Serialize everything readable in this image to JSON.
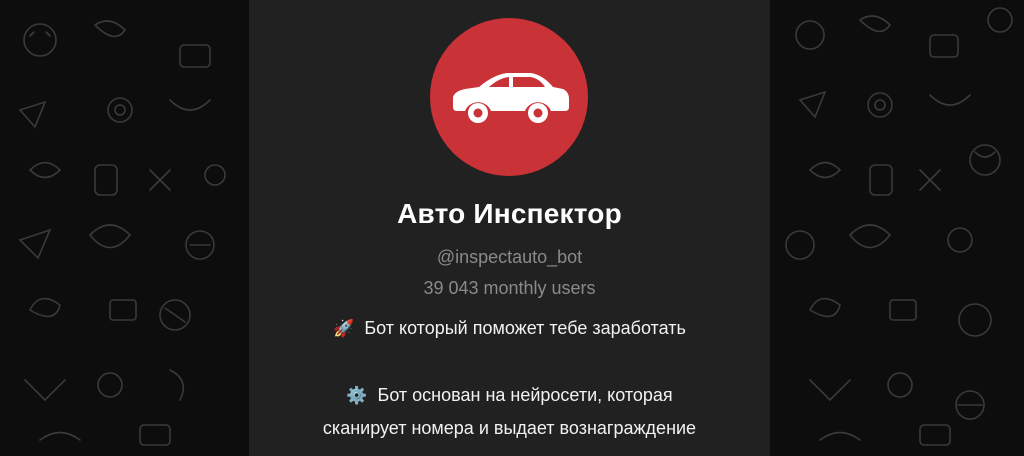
{
  "bot": {
    "name": "Авто Инспектор",
    "username": "@inspectauto_bot",
    "monthly_users": "39 043 monthly users",
    "avatar_color": "#c93236",
    "avatar_icon": "car-icon"
  },
  "description": {
    "line1_emoji": "🚀",
    "line1_text": "Бот который поможет тебе заработать",
    "line2_emoji": "⚙️",
    "line2_text": "Бот основан на нейросети, которая",
    "line3_text": "сканирует номера и выдает вознаграждение"
  },
  "colors": {
    "panel": "#212121",
    "background": "#0d0d0d",
    "muted_text": "#8a8a8a"
  }
}
